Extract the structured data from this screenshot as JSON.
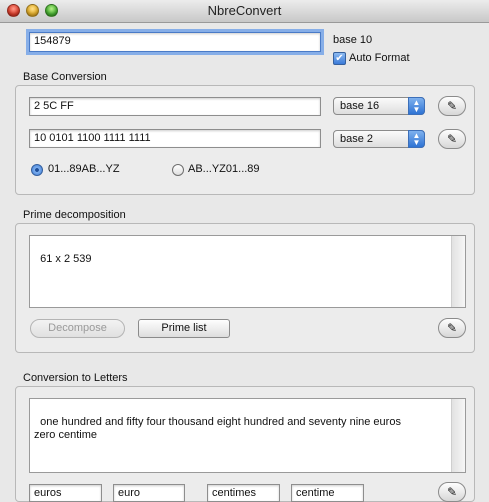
{
  "window": {
    "title": "NbreConvert"
  },
  "input": {
    "value": "154879",
    "base_label": "base 10",
    "auto_format_label": "Auto Format",
    "auto_format_checked": true
  },
  "base_conversion": {
    "heading": "Base Conversion",
    "rows": [
      {
        "value": "2 5C FF",
        "base": "base 16"
      },
      {
        "value": "10 0101 1100 1111 1111",
        "base": "base 2"
      }
    ],
    "radio_options": [
      "01...89AB...YZ",
      "AB...YZ01...89"
    ],
    "radio_selected": 0
  },
  "prime": {
    "heading": "Prime decomposition",
    "result": "61 x 2 539",
    "decompose_label": "Decompose",
    "prime_list_label": "Prime list"
  },
  "letters": {
    "heading": "Conversion to Letters",
    "text": "one hundred and fifty four thousand eight hundred and seventy nine euros\nzero centime",
    "fields": [
      "euros",
      "euro",
      "centimes",
      "centime"
    ]
  },
  "icons": {
    "pencil": "pencil-icon",
    "popup_arrows": "updown-arrows-icon",
    "check": "checkmark-icon"
  }
}
